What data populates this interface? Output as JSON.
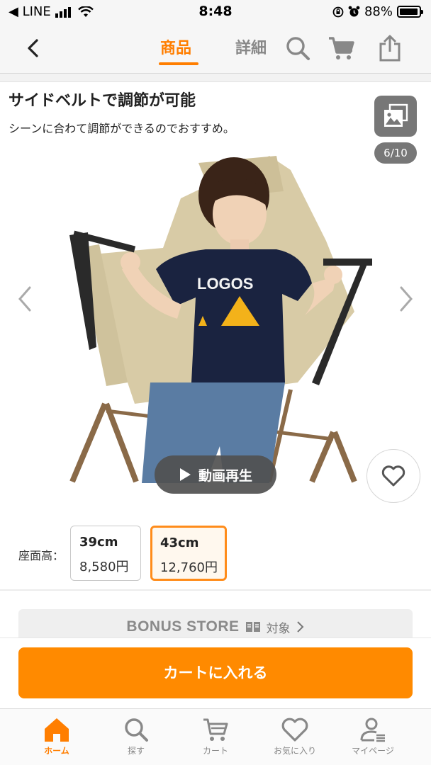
{
  "status_bar": {
    "back_app": "◀ LINE",
    "time": "8:48",
    "battery": "88%",
    "battery_level": 0.88
  },
  "header": {
    "tab_product": "商品",
    "tab_detail": "詳細",
    "icons": [
      "chevron-left-icon",
      "search-icon",
      "cart-icon",
      "share-icon"
    ]
  },
  "product": {
    "title": "サイドベルトで調節が可能",
    "subtitle": "シーンに合わて調節ができるのでおすすめ。",
    "image_counter": "6/10",
    "video_label": "動画再生"
  },
  "options": {
    "label": "座面高：",
    "items": [
      {
        "size": "39cm",
        "price": "8,580円",
        "selected": false
      },
      {
        "size": "43cm",
        "price": "12,760円",
        "selected": true
      }
    ]
  },
  "bonus": {
    "brand": "BONUS STORE",
    "label": "対象"
  },
  "cart_button": "カートに入れる",
  "tabbar": {
    "items": [
      {
        "label": "ホーム",
        "icon": "home-icon",
        "active": true
      },
      {
        "label": "探す",
        "icon": "search-icon",
        "active": false
      },
      {
        "label": "カート",
        "icon": "cart-icon",
        "active": false
      },
      {
        "label": "お気に入り",
        "icon": "heart-icon",
        "active": false
      },
      {
        "label": "マイページ",
        "icon": "user-icon",
        "active": false
      }
    ]
  },
  "colors": {
    "accent": "#ff7e00",
    "button": "#ff8a00",
    "text": "#222222"
  }
}
